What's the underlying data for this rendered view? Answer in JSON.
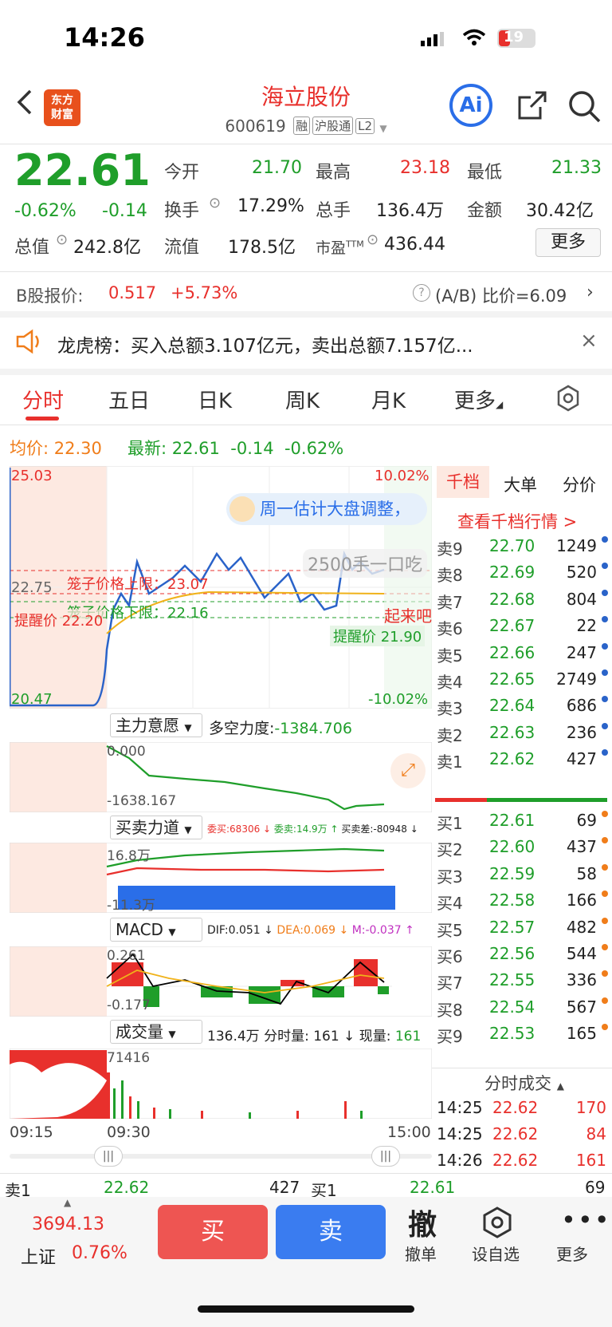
{
  "status_bar": {
    "time": "14:26",
    "battery": "19"
  },
  "header": {
    "title": "海立股份",
    "code": "600619",
    "tags": [
      "融",
      "沪股通",
      "L2"
    ],
    "logo_text": "东方财富"
  },
  "quote": {
    "price": "22.61",
    "change_pct": "-0.62%",
    "change": "-0.14",
    "open_label": "今开",
    "open": "21.70",
    "high_label": "最高",
    "high": "23.18",
    "low_label": "最低",
    "low": "21.33",
    "turnover_label": "换手",
    "turnover": "17.29%",
    "volume_label": "总手",
    "volume": "136.4万",
    "amount_label": "金额",
    "amount": "30.42亿",
    "mktcap_label": "总值",
    "mktcap": "242.8亿",
    "float_label": "流值",
    "float": "178.5亿",
    "pe_label": "市盈",
    "pe_sup": "TTM",
    "pe": "436.44",
    "more": "更多"
  },
  "b_share": {
    "label": "B股报价:",
    "price": "0.517",
    "change": "+5.73%",
    "ratio": "(A/B) 比价=6.09"
  },
  "notice": {
    "text": "龙虎榜：买入总额3.107亿元，卖出总额7.157亿..."
  },
  "tabs": [
    "分时",
    "五日",
    "日K",
    "周K",
    "月K",
    "更多"
  ],
  "avg_line": {
    "avg_label": "均价:",
    "avg": "22.30",
    "latest_label": "最新:",
    "latest": "22.61",
    "chg": "-0.14",
    "pct": "-0.62%"
  },
  "chart": {
    "y_high": "25.03",
    "y_mid": "22.75",
    "y_low": "20.47",
    "pct_high": "10.02%",
    "pct_low": "-10.02%",
    "upper_limit": "笼子价格上限：23.07",
    "lower_limit": "笼子价格下限：22.16",
    "alert_left": "提醒价 22.20",
    "alert_right": "提醒价 21.90",
    "bubble": "周一估计大盘调整，",
    "vol_tip": "2500手一口吃",
    "side_tip": "起来吧",
    "x_start": "09:15",
    "x_open": "09:30",
    "x_end": "15:00"
  },
  "indicators": {
    "main_force": {
      "name": "主力意愿",
      "label": "多空力度:",
      "value": "-1384.706",
      "top": "0.000",
      "bottom": "-1638.167"
    },
    "buysell": {
      "name": "买卖力道",
      "wb": "委买:68306 ↓",
      "ws": "委卖:14.9万 ↑",
      "diff": "买卖差:-80948 ↓",
      "top": "16.8万",
      "bottom": "-11.3万"
    },
    "macd": {
      "name": "MACD",
      "dif": "DIF:0.051 ↓",
      "dea": "DEA:0.069 ↓",
      "m": "M:-0.037 ↑",
      "top": "0.261",
      "bottom": "-0.177"
    },
    "volume": {
      "name": "成交量",
      "total": "136.4万",
      "fen": "分时量: 161 ↓",
      "now_label": "现量:",
      "now": "161",
      "top": "71416"
    }
  },
  "orderbook": {
    "tabs": [
      "千档",
      "大单",
      "分价"
    ],
    "link": "查看千档行情 >",
    "asks": [
      [
        "卖9",
        "22.70",
        "1249"
      ],
      [
        "卖8",
        "22.69",
        "520"
      ],
      [
        "卖7",
        "22.68",
        "804"
      ],
      [
        "卖6",
        "22.67",
        "22"
      ],
      [
        "卖5",
        "22.66",
        "247"
      ],
      [
        "卖4",
        "22.65",
        "2749"
      ],
      [
        "卖3",
        "22.64",
        "686"
      ],
      [
        "卖2",
        "22.63",
        "236"
      ],
      [
        "卖1",
        "22.62",
        "427"
      ]
    ],
    "bids": [
      [
        "买1",
        "22.61",
        "69"
      ],
      [
        "买2",
        "22.60",
        "437"
      ],
      [
        "买3",
        "22.59",
        "58"
      ],
      [
        "买4",
        "22.58",
        "166"
      ],
      [
        "买5",
        "22.57",
        "482"
      ],
      [
        "买6",
        "22.56",
        "544"
      ],
      [
        "买7",
        "22.55",
        "336"
      ],
      [
        "买8",
        "22.54",
        "567"
      ],
      [
        "买9",
        "22.53",
        "165"
      ]
    ],
    "trades_title": "分时成交",
    "trades": [
      [
        "14:25",
        "22.62",
        "170"
      ],
      [
        "14:25",
        "22.62",
        "84"
      ],
      [
        "14:26",
        "22.62",
        "161"
      ]
    ]
  },
  "bottom_quote": {
    "s_label": "卖1",
    "s_price": "22.62",
    "s_vol": "427",
    "b_label": "买1",
    "b_price": "22.61",
    "b_vol": "69"
  },
  "footer": {
    "index_value": "3694.13",
    "index_name": "上证",
    "index_pct": "0.76%",
    "buy": "买",
    "sell": "卖",
    "cancel": "撤单",
    "cancel_icon": "撤",
    "watch": "设自选",
    "more": "更多"
  }
}
